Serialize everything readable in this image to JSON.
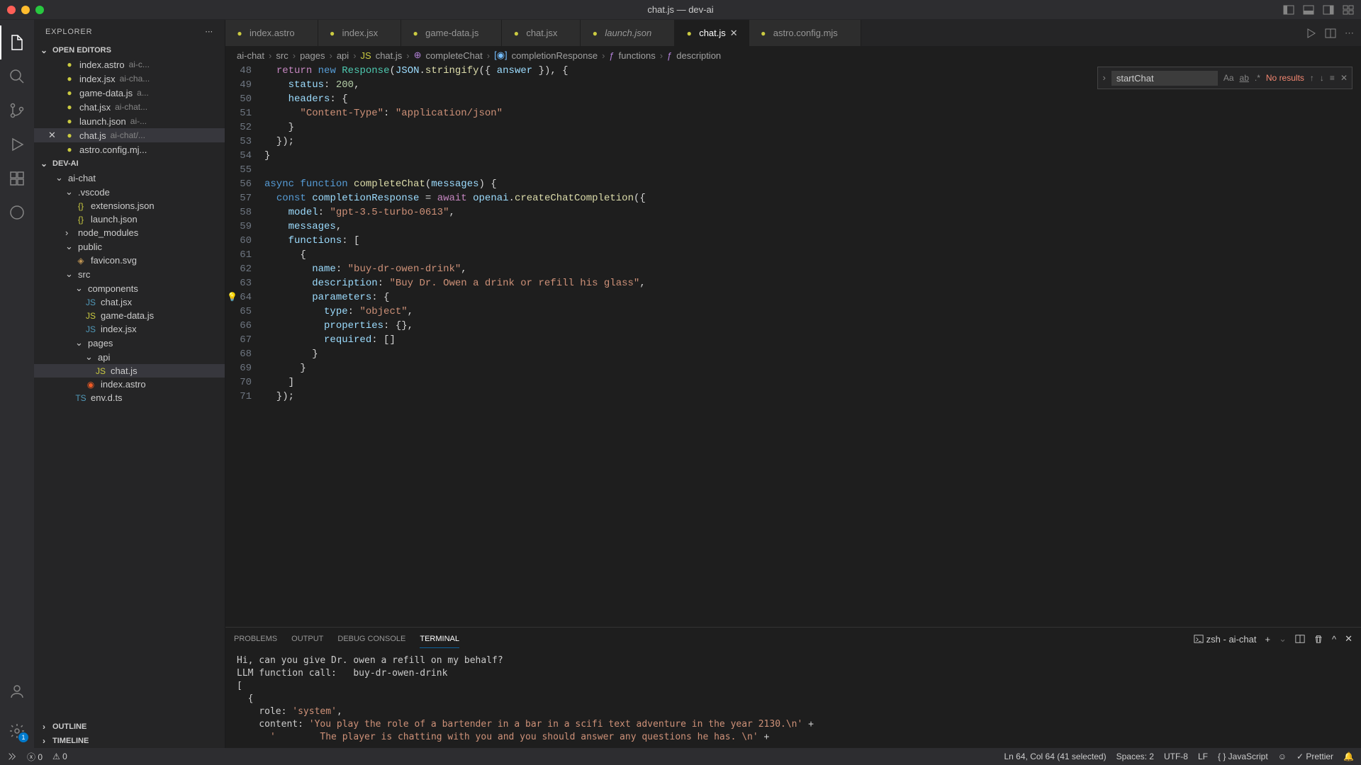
{
  "title": "chat.js — dev-ai",
  "sidebar": {
    "header": "EXPLORER",
    "open_editors_label": "OPEN EDITORS",
    "project_label": "DEV-AI",
    "outline_label": "OUTLINE",
    "timeline_label": "TIMELINE",
    "open_editors": [
      {
        "name": "index.astro",
        "meta": "ai-c..."
      },
      {
        "name": "index.jsx",
        "meta": "ai-cha..."
      },
      {
        "name": "game-data.js",
        "meta": "a..."
      },
      {
        "name": "chat.jsx",
        "meta": "ai-chat..."
      },
      {
        "name": "launch.json",
        "meta": "ai-..."
      },
      {
        "name": "chat.js",
        "meta": "ai-chat/...",
        "active": true
      },
      {
        "name": "astro.config.mj...",
        "meta": ""
      }
    ],
    "tree": {
      "ai_chat": "ai-chat",
      "vscode": ".vscode",
      "extensions": "extensions.json",
      "launch": "launch.json",
      "node_modules": "node_modules",
      "public": "public",
      "favicon": "favicon.svg",
      "src": "src",
      "components": "components",
      "chat_jsx": "chat.jsx",
      "game_data": "game-data.js",
      "index_jsx": "index.jsx",
      "pages": "pages",
      "api": "api",
      "chat_js": "chat.js",
      "index_astro": "index.astro",
      "env": "env.d.ts"
    }
  },
  "tabs": [
    {
      "name": "index.astro"
    },
    {
      "name": "index.jsx"
    },
    {
      "name": "game-data.js"
    },
    {
      "name": "chat.jsx"
    },
    {
      "name": "launch.json",
      "italic": true
    },
    {
      "name": "chat.js",
      "active": true
    },
    {
      "name": "astro.config.mjs"
    }
  ],
  "breadcrumb": {
    "p0": "ai-chat",
    "p1": "src",
    "p2": "pages",
    "p3": "api",
    "p4": "chat.js",
    "p5": "completeChat",
    "p6": "completionResponse",
    "p7": "functions",
    "p8": "description"
  },
  "find": {
    "query": "startChat",
    "results": "No results"
  },
  "gutter_start": 48,
  "code_lines": [
    "  <kw>return</kw> <kw2>new</kw2> <type>Response</type>(<var>JSON</var>.<fn>stringify</fn>({ <var>answer</var> }), {",
    "    <var>status</var>: <num>200</num>,",
    "    <var>headers</var>: {",
    "      <str>\"Content-Type\"</str>: <str>\"application/json\"</str>",
    "    }",
    "  });",
    "}",
    "",
    "<kw2>async</kw2> <kw2>function</kw2> <fn>completeChat</fn>(<var>messages</var>) {",
    "  <kw2>const</kw2> <var>completionResponse</var> = <kw>await</kw> <var>openai</var>.<fn>createChatCompletion</fn>({",
    "    <var>model</var>: <str>\"gpt-3.5-turbo-0613\"</str>,",
    "    <var>messages</var>,",
    "    <var>functions</var>: [",
    "      {",
    "        <var>name</var>: <str>\"buy-dr-owen-drink\"</str>,",
    "        <var>description</var>: <str>\"Buy Dr. Owen a drink or refill his glass\"</str>,",
    "        <var>parameters</var>: {",
    "          <var>type</var>: <str>\"object\"</str>,",
    "          <var>properties</var>: {},",
    "          <var>required</var>: []",
    "        }",
    "      }",
    "    ]",
    "  });"
  ],
  "panel": {
    "problems": "PROBLEMS",
    "output": "OUTPUT",
    "debug_console": "DEBUG CONSOLE",
    "terminal": "TERMINAL",
    "shell": "zsh - ai-chat",
    "body": "Hi, can you give Dr. owen a refill on my behalf?\nLLM function call:   buy-dr-owen-drink\n[\n  {\n    role: 'system',\n    content: 'You play the role of a bartender in a bar in a scifi text adventure in the year 2130.\\n' +\n      '        The player is chatting with you and you should answer any questions he has. \\n' +"
  },
  "statusbar": {
    "errors": "0",
    "warnings": "0",
    "position": "Ln 64, Col 64 (41 selected)",
    "spaces": "Spaces: 2",
    "encoding": "UTF-8",
    "eol": "LF",
    "lang": "JavaScript",
    "prettier": "Prettier"
  }
}
